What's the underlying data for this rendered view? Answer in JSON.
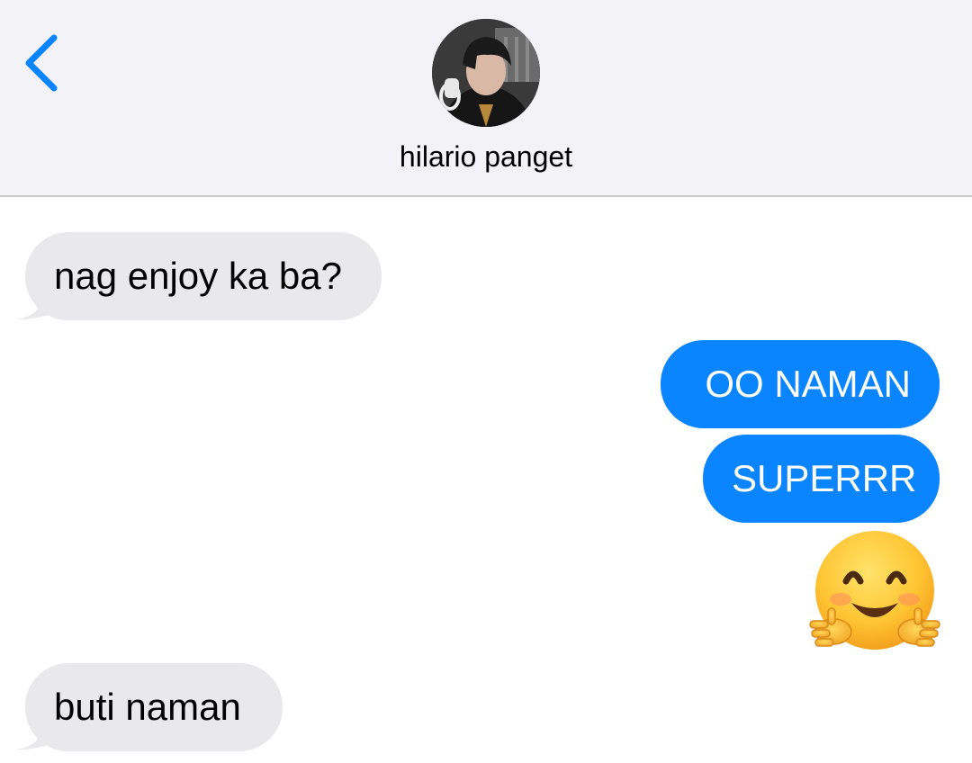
{
  "header": {
    "contact_name": "hilario panget",
    "back_icon": "chevron-left-icon",
    "accent_color": "#0a84ff",
    "background_color": "#f2f2f7"
  },
  "messages": [
    {
      "direction": "incoming",
      "text": "nag enjoy ka ba?"
    },
    {
      "direction": "outgoing",
      "text": "OO NAMAN"
    },
    {
      "direction": "outgoing",
      "text": "SUPERRR"
    },
    {
      "direction": "outgoing",
      "type": "emoji",
      "icon": "hugging-face-emoji-icon"
    },
    {
      "direction": "incoming",
      "text": "buti naman"
    }
  ],
  "colors": {
    "incoming_bubble": "#e9e9eb",
    "outgoing_bubble": "#0a84ff"
  }
}
